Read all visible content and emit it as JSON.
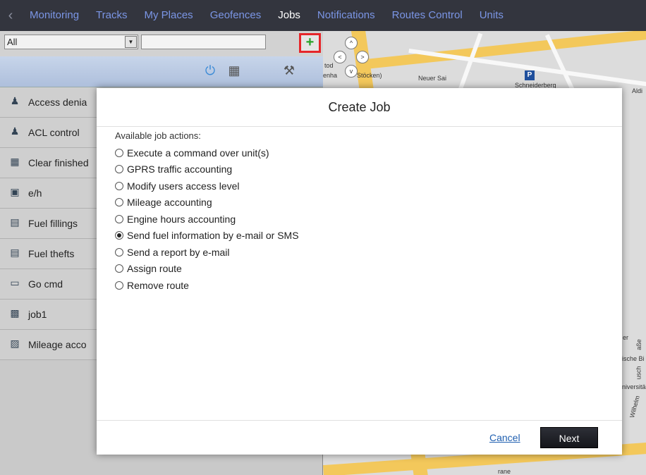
{
  "nav": {
    "back_icon": "chevron-left-icon",
    "tabs": [
      {
        "label": "Monitoring",
        "active": false
      },
      {
        "label": "Tracks",
        "active": false
      },
      {
        "label": "My Places",
        "active": false
      },
      {
        "label": "Geofences",
        "active": false
      },
      {
        "label": "Jobs",
        "active": true
      },
      {
        "label": "Notifications",
        "active": false
      },
      {
        "label": "Routes Control",
        "active": false
      },
      {
        "label": "Units",
        "active": false
      }
    ]
  },
  "filter": {
    "select_value": "All",
    "add_label": "+"
  },
  "toolbar": {
    "icons": [
      "power-icon",
      "calendar-icon",
      "wrench-icon"
    ]
  },
  "jobs": [
    {
      "name": "Access denia",
      "icon": "users-key-icon"
    },
    {
      "name": "ACL control",
      "icon": "users-key-icon"
    },
    {
      "name": "Clear finished",
      "icon": "clear-report-icon"
    },
    {
      "name": "e/h",
      "icon": "engine-hours-icon"
    },
    {
      "name": "Fuel fillings",
      "icon": "fuel-icon"
    },
    {
      "name": "Fuel thefts",
      "icon": "fuel-icon"
    },
    {
      "name": "Go cmd",
      "icon": "command-icon"
    },
    {
      "name": "job1",
      "icon": "job-green-icon"
    },
    {
      "name": "Mileage acco",
      "icon": "mileage-icon"
    }
  ],
  "map": {
    "labels": [
      "tod",
      "enha",
      "Stöcken)",
      "Neuer Sai",
      "Schneiderberg",
      "Aldi",
      "er",
      "ische Bi",
      "aße",
      "usch",
      "niversitä",
      "Wilhelm",
      "rane"
    ],
    "parking": "P"
  },
  "modal": {
    "title": "Create Job",
    "available_label": "Available job actions:",
    "options": [
      {
        "label": "Execute a command over unit(s)",
        "checked": false
      },
      {
        "label": "GPRS traffic accounting",
        "checked": false
      },
      {
        "label": "Modify users access level",
        "checked": false
      },
      {
        "label": "Mileage accounting",
        "checked": false
      },
      {
        "label": "Engine hours accounting",
        "checked": false
      },
      {
        "label": "Send fuel information by e-mail or SMS",
        "checked": true
      },
      {
        "label": "Send a report by e-mail",
        "checked": false
      },
      {
        "label": "Assign route",
        "checked": false
      },
      {
        "label": "Remove route",
        "checked": false
      }
    ],
    "cancel_label": "Cancel",
    "next_label": "Next"
  }
}
